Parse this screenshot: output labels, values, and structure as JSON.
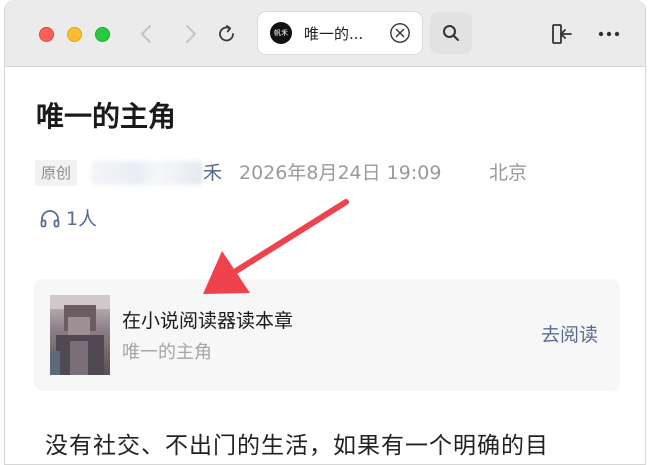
{
  "browser": {
    "tab_title": "唯一的...",
    "tab_favicon_text": "帆禾"
  },
  "article": {
    "title": "唯一的主角",
    "original_tag": "原创",
    "author_visible": "禾",
    "datetime": "2026年8月24日 19:09",
    "location": "北京",
    "listen_count": "1人",
    "body_first_line": "没有社交、不出门的生活，如果有一个明确的目"
  },
  "novel_card": {
    "title": "在小说阅读器读本章",
    "subtitle": "唯一的主角",
    "action_label": "去阅读"
  },
  "colors": {
    "link": "#576b95",
    "meta_gray": "#9a9a9a",
    "annotation_arrow": "#f0424c"
  }
}
